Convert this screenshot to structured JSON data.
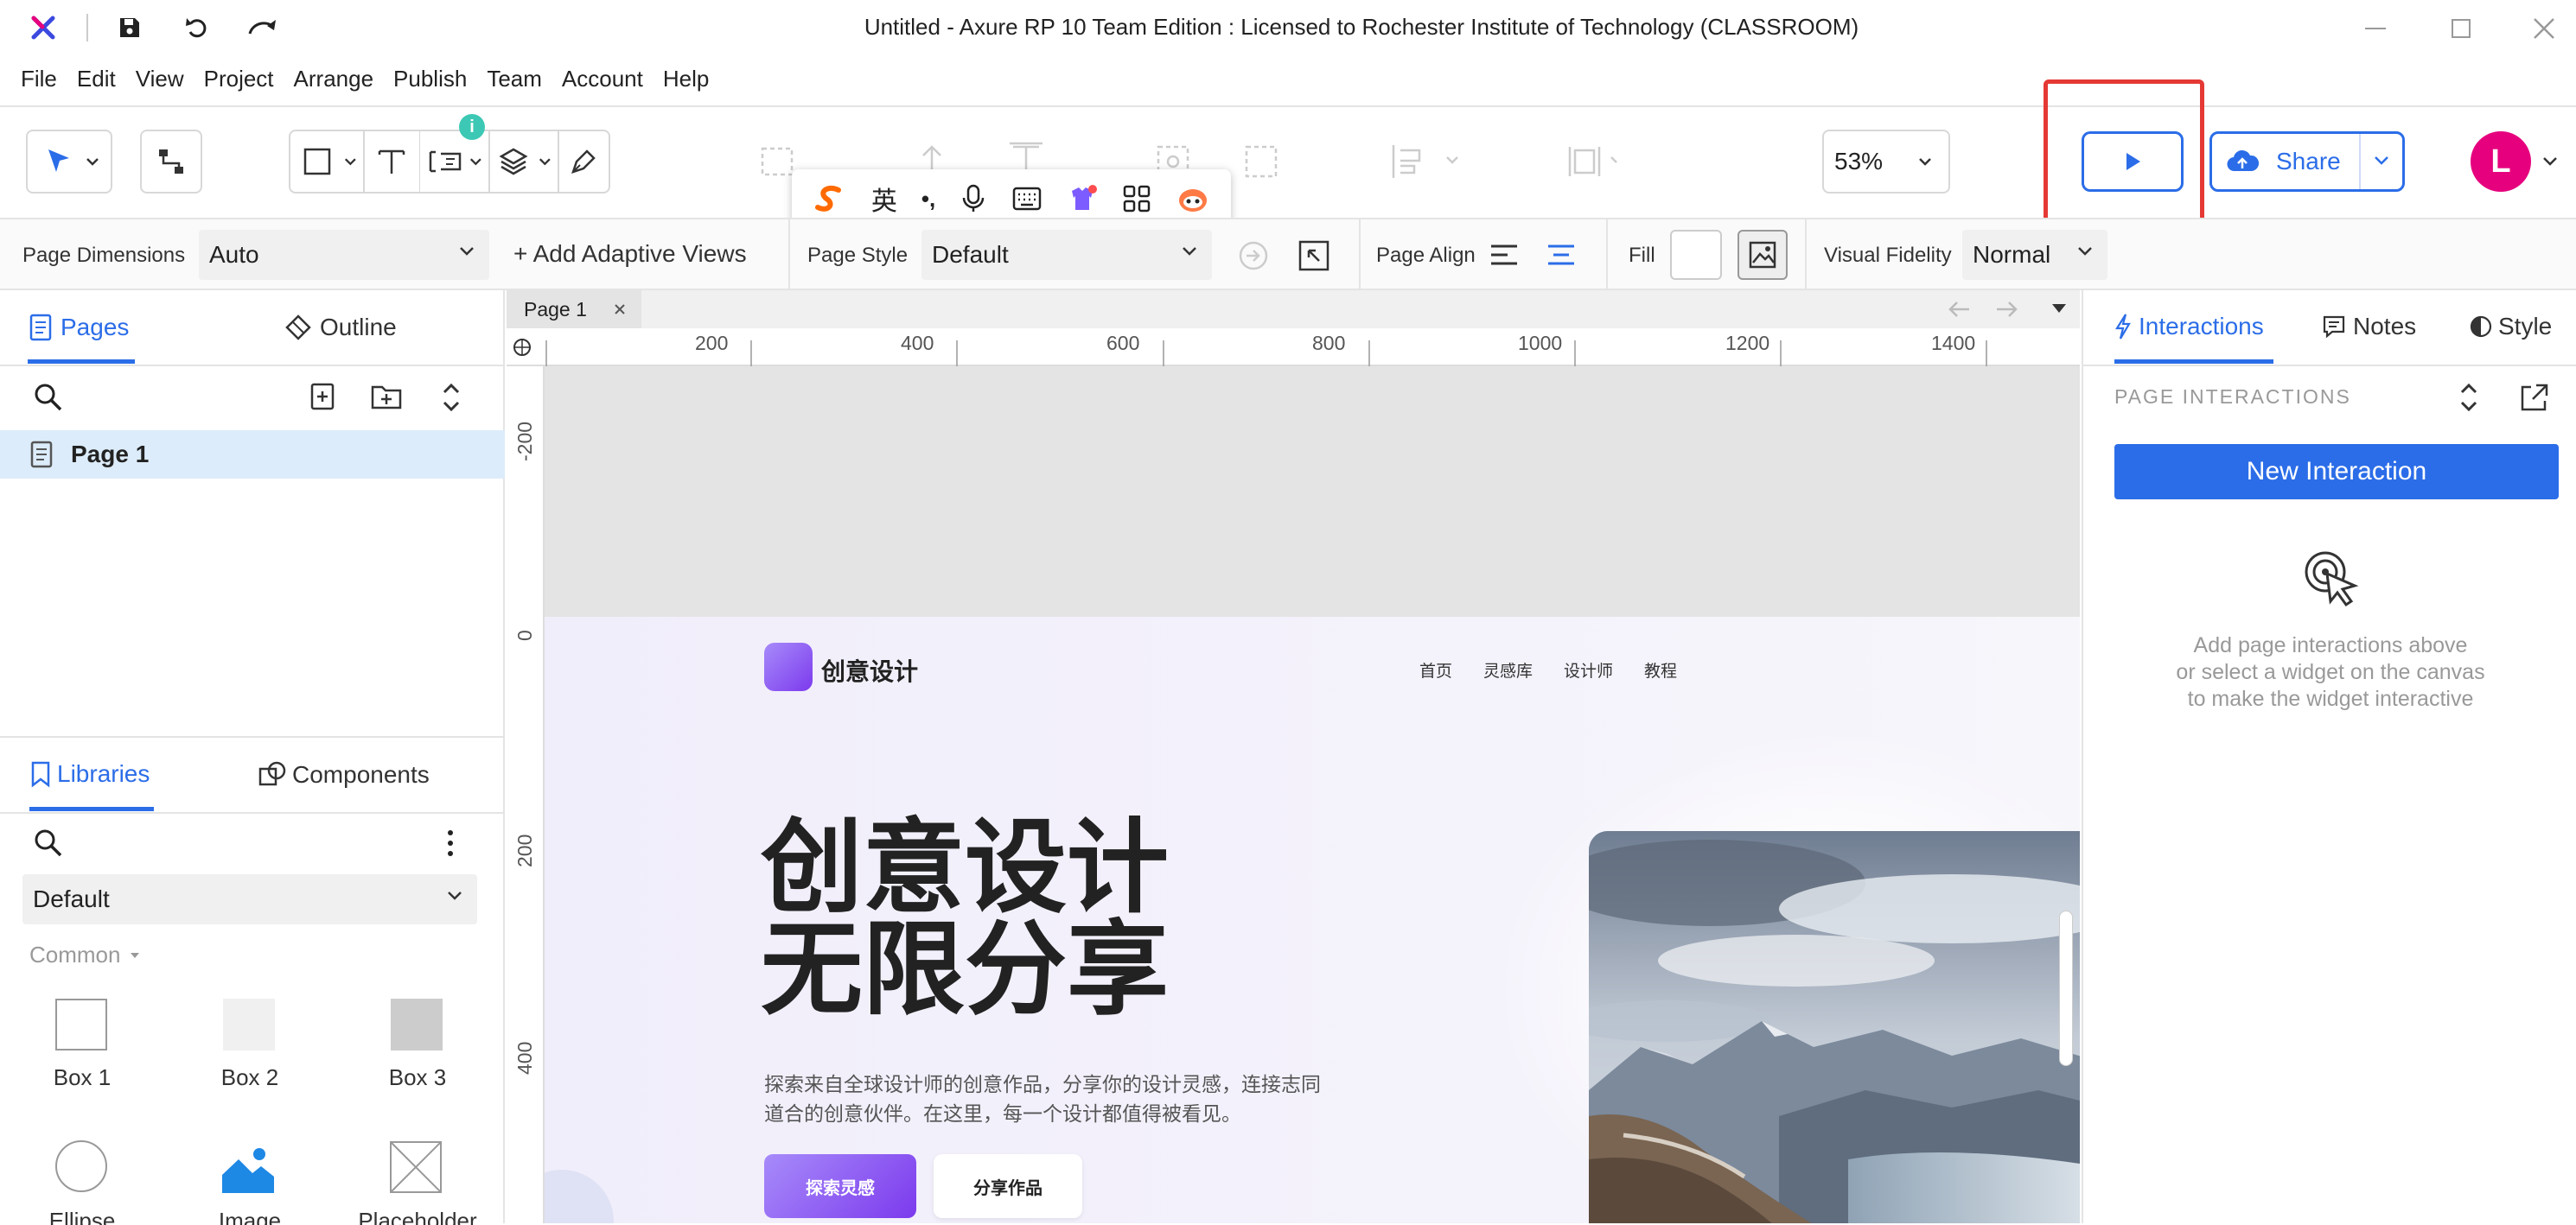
{
  "window": {
    "title": "Untitled - Axure RP 10 Team Edition : Licensed to Rochester Institute of Technology (CLASSROOM)"
  },
  "menu": [
    "File",
    "Edit",
    "View",
    "Project",
    "Arrange",
    "Publish",
    "Team",
    "Account",
    "Help"
  ],
  "toolbar": {
    "zoom": "53%",
    "share": "Share",
    "avatar": "L",
    "badge": "i"
  },
  "ime": {
    "lang": "英",
    "punct": "•,"
  },
  "props": {
    "page_dimensions_label": "Page Dimensions",
    "page_dimensions_value": "Auto",
    "add_views": "+ Add Adaptive Views",
    "page_style_label": "Page Style",
    "page_style_value": "Default",
    "page_align_label": "Page Align",
    "fill_label": "Fill",
    "visual_fidelity_label": "Visual Fidelity",
    "visual_fidelity_value": "Normal"
  },
  "left": {
    "tabs": [
      "Pages",
      "Outline"
    ],
    "page": "Page 1",
    "lib_tabs": [
      "Libraries",
      "Components"
    ],
    "library": "Default",
    "category": "Common",
    "widgets": [
      "Box 1",
      "Box 2",
      "Box 3",
      "Ellipse",
      "Image",
      "Placeholder"
    ]
  },
  "canvas": {
    "tab": "Page 1",
    "hticks": [
      "200",
      "400",
      "600",
      "800",
      "1000",
      "1200",
      "1400"
    ],
    "vticks": [
      "-200",
      "0",
      "200",
      "400"
    ]
  },
  "site": {
    "brand": "创意设计",
    "nav": [
      "首页",
      "灵感库",
      "设计师",
      "教程"
    ],
    "headline1": "创意设计",
    "headline2": "无限分享",
    "desc1": "探索来自全球设计师的创意作品，分享你的设计灵感，连接志同",
    "desc2": "道合的创意伙伴。在这里，每一个设计都值得被看见。",
    "btn_primary": "探索灵感",
    "btn_secondary": "分享作品"
  },
  "right": {
    "tabs": [
      "Interactions",
      "Notes",
      "Style"
    ],
    "section": "PAGE INTERACTIONS",
    "new_interaction": "New Interaction",
    "empty1": "Add page interactions above",
    "empty2": "or select a widget on the canvas",
    "empty3": "to make the widget interactive"
  },
  "colors": {
    "accent": "#2b6de8",
    "highlight": "#e53935",
    "avatar": "#e6007e",
    "brand": "#8b5cf6"
  }
}
